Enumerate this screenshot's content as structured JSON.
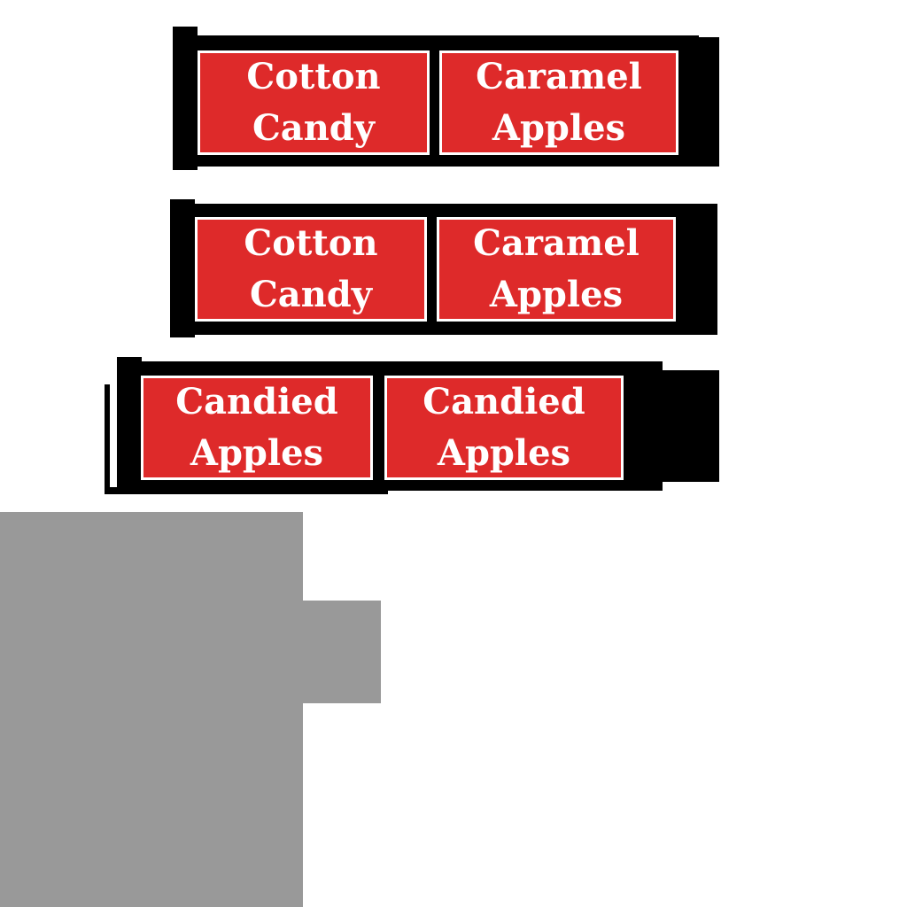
{
  "colors": {
    "sign_red": "#de2a2a",
    "sign_text": "#ffffff",
    "bar_black": "#000000",
    "placeholder_grey": "#999999",
    "background": "#ffffff"
  },
  "rows": [
    {
      "signs": [
        {
          "line1": "Cotton",
          "line2": "Candy"
        },
        {
          "line1": "Caramel",
          "line2": "Apples"
        }
      ]
    },
    {
      "signs": [
        {
          "line1": "Cotton",
          "line2": "Candy"
        },
        {
          "line1": "Caramel",
          "line2": "Apples"
        }
      ]
    },
    {
      "signs": [
        {
          "line1": "Candied",
          "line2": "Apples"
        },
        {
          "line1": "Candied",
          "line2": "Apples"
        }
      ]
    }
  ]
}
